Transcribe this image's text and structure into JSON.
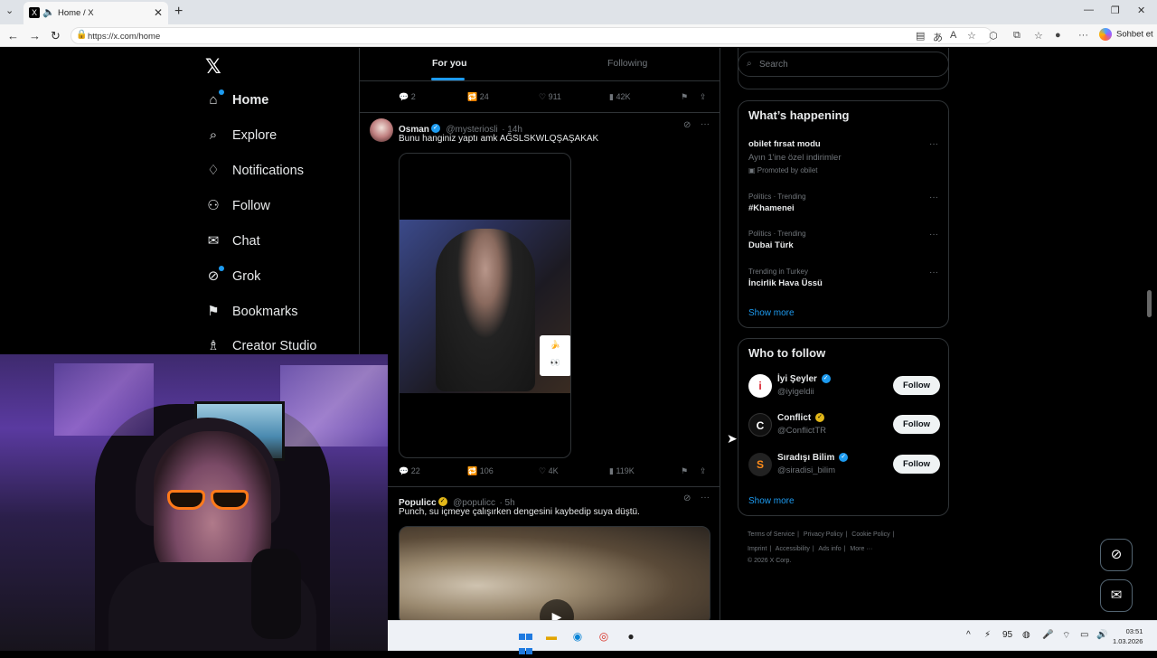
{
  "browser": {
    "tab_title": "Home / X",
    "url": "https://x.com/home",
    "copilot_label": "Sohbet et"
  },
  "nav": {
    "logo": "𝕏",
    "items": [
      {
        "label": "Home",
        "icon": "home-icon"
      },
      {
        "label": "Explore",
        "icon": "search-icon"
      },
      {
        "label": "Notifications",
        "icon": "bell-icon"
      },
      {
        "label": "Follow",
        "icon": "add-person-icon"
      },
      {
        "label": "Chat",
        "icon": "envelope-icon"
      },
      {
        "label": "Grok",
        "icon": "grok-icon"
      },
      {
        "label": "Bookmarks",
        "icon": "bookmark-icon"
      },
      {
        "label": "Creator Studio",
        "icon": "creator-icon"
      }
    ]
  },
  "timeline": {
    "tabs": [
      "For you",
      "Following"
    ],
    "prev_tweet_actions": {
      "replies": "2",
      "reposts": "24",
      "likes": "911",
      "views": "42K"
    },
    "tweets": [
      {
        "name": "Osman",
        "handle": "@mysteriosli",
        "time": "· 14h",
        "text": "Bunu hanginiz yaptı amk AĞSLSKWLQŞAŞAKAK",
        "replies": "22",
        "reposts": "106",
        "likes": "4K",
        "views": "119K"
      },
      {
        "name": "Populicc",
        "handle": "@populicc",
        "time": "· 5h",
        "text": "Punch, su içmeye çalışırken dengesini kaybedip suya düştü."
      }
    ]
  },
  "right": {
    "search_placeholder": "Search",
    "whats_happening": {
      "title": "What’s happening",
      "trends": [
        {
          "meta": "",
          "topic": "obilet fırsat modu",
          "sub": "Ayın 1'ine özel indirimler",
          "promo": "Promoted by obilet"
        },
        {
          "meta": "Politics · Trending",
          "topic": "#Khamenei"
        },
        {
          "meta": "Politics · Trending",
          "topic": "Dubai Türk"
        },
        {
          "meta": "Trending in Turkey",
          "topic": "İncirlik Hava Üssü"
        }
      ],
      "show_more": "Show more"
    },
    "who_to_follow": {
      "title": "Who to follow",
      "accounts": [
        {
          "name": "İyi Şeyler",
          "handle": "@iyigeldii",
          "button": "Follow"
        },
        {
          "name": "Conflict",
          "handle": "@ConflictTR",
          "button": "Follow"
        },
        {
          "name": "Sıradışı Bilim",
          "handle": "@siradisi_bilim",
          "button": "Follow"
        }
      ],
      "show_more": "Show more"
    },
    "footer": {
      "links": [
        "Terms of Service",
        "|",
        "Privacy Policy",
        "|",
        "Cookie Policy",
        "|",
        "Imprint",
        "|",
        "Accessibility",
        "|",
        "Ads info",
        "|",
        "More ···"
      ],
      "copyright": "© 2026 X Corp."
    }
  },
  "taskbar": {
    "battery_label": "95",
    "time": "03:51",
    "date": "1.03.2026"
  },
  "colors": {
    "accent": "#1d9bf0",
    "background": "#000000",
    "border": "#2f3336",
    "muted_text": "#71767b"
  }
}
